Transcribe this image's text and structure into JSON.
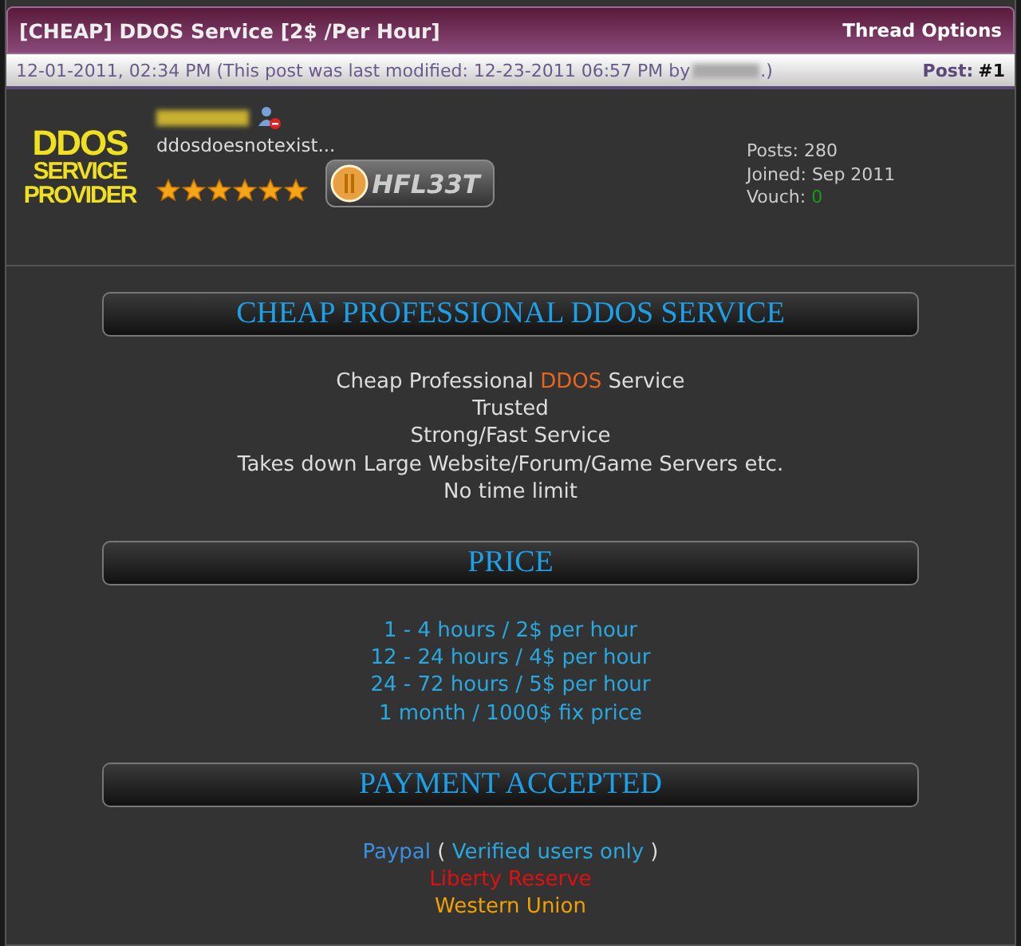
{
  "thread": {
    "title": "[CHEAP] DDOS Service [2$ /Per Hour]",
    "options": "Thread Options"
  },
  "post_bar": {
    "date": "12-01-2011, 02:34 PM (This post was last modified: 12-23-2011 06:57 PM by",
    "date_end": ".)",
    "post_label": "Post:",
    "post_number": "#1"
  },
  "author": {
    "avatar_lines": [
      "DDOS",
      "SERVICE",
      "PROVIDER"
    ],
    "online": false,
    "usertitle": "ddosdoesnotexist...",
    "stars": 6,
    "badge": "HFL33T",
    "posts": "Posts: 280",
    "joined": "Joined: Sep 2011",
    "vouch_label": "Vouch:",
    "vouch": "0"
  },
  "sections": [
    {
      "heading": "CHEAP PROFESSIONAL DDOS SERVICE",
      "lines": [
        [
          {
            "text": "Cheap Professional ",
            "color": "#dddddd"
          },
          {
            "text": "DDOS",
            "color": "#e8641e"
          },
          {
            "text": " Service",
            "color": "#dddddd"
          }
        ],
        [
          {
            "text": "Trusted",
            "color": "#dddddd"
          }
        ],
        [
          {
            "text": "Strong/Fast Service",
            "color": "#dddddd"
          }
        ],
        [
          {
            "text": "Takes down Large Website/Forum/Game Servers etc.",
            "color": "#dddddd"
          }
        ],
        [
          {
            "text": "No time limit",
            "color": "#dddddd"
          }
        ]
      ]
    },
    {
      "heading": "PRICE",
      "lines": [
        [
          {
            "text": "1 - 4 hours / 2$ per hour",
            "color": "#29a8e0"
          }
        ],
        [
          {
            "text": "12 - 24 hours / 4$ per hour",
            "color": "#29a8e0"
          }
        ],
        [
          {
            "text": "24 - 72 hours / 5$ per hour",
            "color": "#29a8e0"
          }
        ],
        [
          {
            "text": "1 month / 1000$ fix price",
            "color": "#29a8e0"
          }
        ]
      ]
    },
    {
      "heading": "PAYMENT ACCEPTED",
      "lines": [
        [
          {
            "text": "Paypal",
            "color": "#3b8fe0"
          },
          {
            "text": " ( ",
            "color": "#dddddd"
          },
          {
            "text": "Verified users only",
            "color": "#29a8e0"
          },
          {
            "text": " )",
            "color": "#dddddd"
          }
        ],
        [
          {
            "text": "Liberty Reserve",
            "color": "#e01010"
          }
        ],
        [
          {
            "text": "Western Union",
            "color": "#f0a000"
          }
        ]
      ]
    }
  ]
}
